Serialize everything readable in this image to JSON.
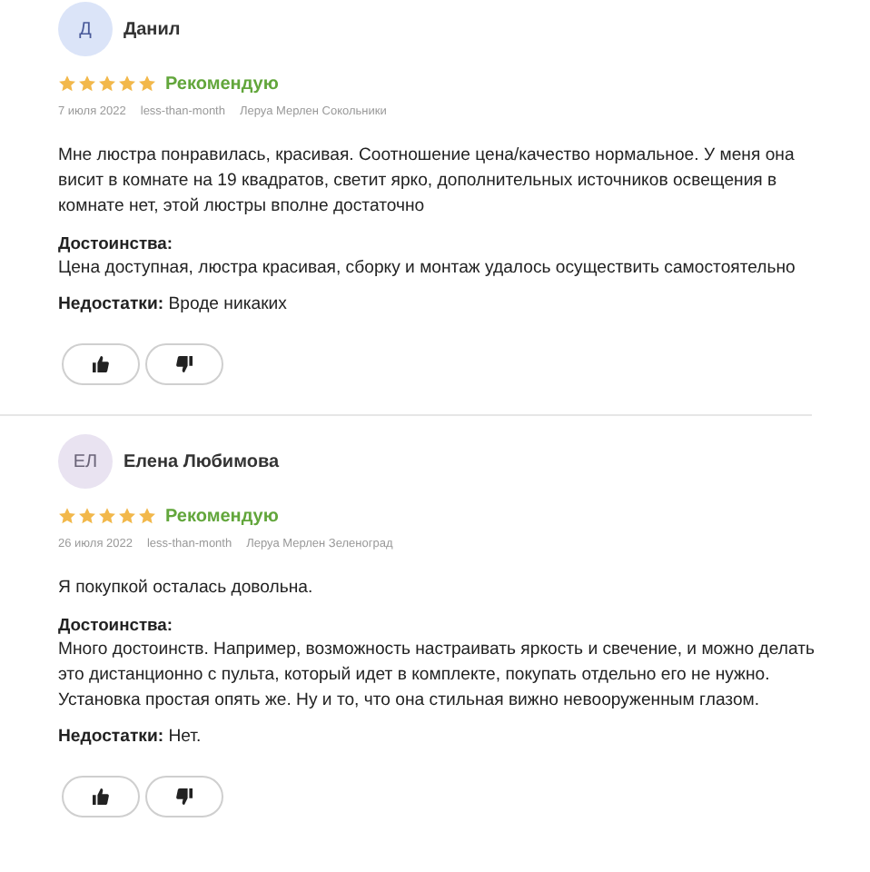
{
  "reviews": [
    {
      "initials": "Д",
      "color": "#dbe4f8",
      "name": "Данил",
      "stars": 5,
      "verdict": "Рекомендую",
      "date": "7 июля 2022",
      "usage": "less-than-month",
      "store": "Леруа Мерлен Сокольники",
      "text": "Мне люстра понравилась, красивая. Соотношение цена/качество нормальное. У меня она висит в комнате на 19 квадратов, светит ярко, дополнительных источников освещения в комнате нет, этой люстры вполне достаточно",
      "pros_label": "Достоинства:",
      "pros": "Цена доступная, люстра красивая, сборку и монтаж удалось осуществить самостоятельно",
      "cons_label": "Недостатки:",
      "cons": "Вроде никаких"
    },
    {
      "initials": "ЕЛ",
      "color": "#e9e3f1",
      "name": "Елена Любимова",
      "stars": 5,
      "verdict": "Рекомендую",
      "date": "26 июля 2022",
      "usage": "less-than-month",
      "store": "Леруа Мерлен Зеленоград",
      "text": "Я покупкой осталась довольна.",
      "pros_label": "Достоинства:",
      "pros": "Много достоинств. Например, возможность настраивать яркость и свечение, и можно делать это дистанционно с пульта, который идет в комплекте, покупать отдельно его не нужно. Установка простая опять же. Ну и то, что она стильная вижно невооруженным глазом.",
      "cons_label": "Недостатки:",
      "cons": "Нет."
    }
  ]
}
